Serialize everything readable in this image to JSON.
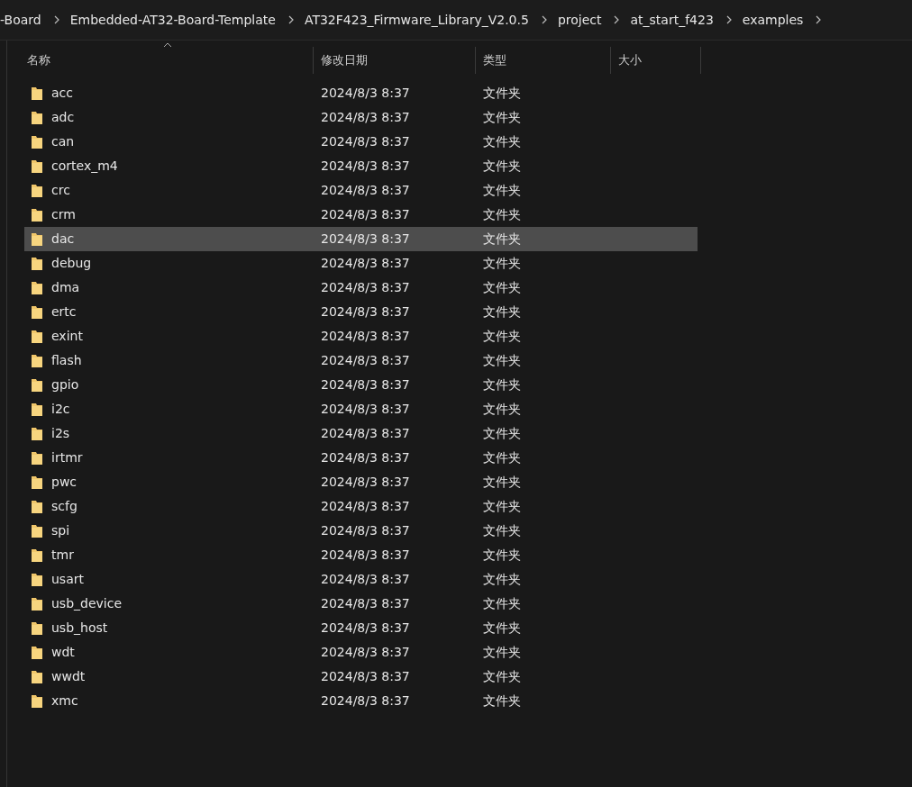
{
  "breadcrumb": [
    "-Board",
    "Embedded-AT32-Board-Template",
    "AT32F423_Firmware_Library_V2.0.5",
    "project",
    "at_start_f423",
    "examples"
  ],
  "columns": [
    {
      "label": "名称",
      "sorted": true
    },
    {
      "label": "修改日期",
      "sorted": false
    },
    {
      "label": "类型",
      "sorted": false
    },
    {
      "label": "大小",
      "sorted": false
    }
  ],
  "rows": [
    {
      "name": "acc",
      "modified": "2024/8/3 8:37",
      "type": "文件夹",
      "selected": false
    },
    {
      "name": "adc",
      "modified": "2024/8/3 8:37",
      "type": "文件夹",
      "selected": false
    },
    {
      "name": "can",
      "modified": "2024/8/3 8:37",
      "type": "文件夹",
      "selected": false
    },
    {
      "name": "cortex_m4",
      "modified": "2024/8/3 8:37",
      "type": "文件夹",
      "selected": false
    },
    {
      "name": "crc",
      "modified": "2024/8/3 8:37",
      "type": "文件夹",
      "selected": false
    },
    {
      "name": "crm",
      "modified": "2024/8/3 8:37",
      "type": "文件夹",
      "selected": false
    },
    {
      "name": "dac",
      "modified": "2024/8/3 8:37",
      "type": "文件夹",
      "selected": true
    },
    {
      "name": "debug",
      "modified": "2024/8/3 8:37",
      "type": "文件夹",
      "selected": false
    },
    {
      "name": "dma",
      "modified": "2024/8/3 8:37",
      "type": "文件夹",
      "selected": false
    },
    {
      "name": "ertc",
      "modified": "2024/8/3 8:37",
      "type": "文件夹",
      "selected": false
    },
    {
      "name": "exint",
      "modified": "2024/8/3 8:37",
      "type": "文件夹",
      "selected": false
    },
    {
      "name": "flash",
      "modified": "2024/8/3 8:37",
      "type": "文件夹",
      "selected": false
    },
    {
      "name": "gpio",
      "modified": "2024/8/3 8:37",
      "type": "文件夹",
      "selected": false
    },
    {
      "name": "i2c",
      "modified": "2024/8/3 8:37",
      "type": "文件夹",
      "selected": false
    },
    {
      "name": "i2s",
      "modified": "2024/8/3 8:37",
      "type": "文件夹",
      "selected": false
    },
    {
      "name": "irtmr",
      "modified": "2024/8/3 8:37",
      "type": "文件夹",
      "selected": false
    },
    {
      "name": "pwc",
      "modified": "2024/8/3 8:37",
      "type": "文件夹",
      "selected": false
    },
    {
      "name": "scfg",
      "modified": "2024/8/3 8:37",
      "type": "文件夹",
      "selected": false
    },
    {
      "name": "spi",
      "modified": "2024/8/3 8:37",
      "type": "文件夹",
      "selected": false
    },
    {
      "name": "tmr",
      "modified": "2024/8/3 8:37",
      "type": "文件夹",
      "selected": false
    },
    {
      "name": "usart",
      "modified": "2024/8/3 8:37",
      "type": "文件夹",
      "selected": false
    },
    {
      "name": "usb_device",
      "modified": "2024/8/3 8:37",
      "type": "文件夹",
      "selected": false
    },
    {
      "name": "usb_host",
      "modified": "2024/8/3 8:37",
      "type": "文件夹",
      "selected": false
    },
    {
      "name": "wdt",
      "modified": "2024/8/3 8:37",
      "type": "文件夹",
      "selected": false
    },
    {
      "name": "wwdt",
      "modified": "2024/8/3 8:37",
      "type": "文件夹",
      "selected": false
    },
    {
      "name": "xmc",
      "modified": "2024/8/3 8:37",
      "type": "文件夹",
      "selected": false
    }
  ]
}
